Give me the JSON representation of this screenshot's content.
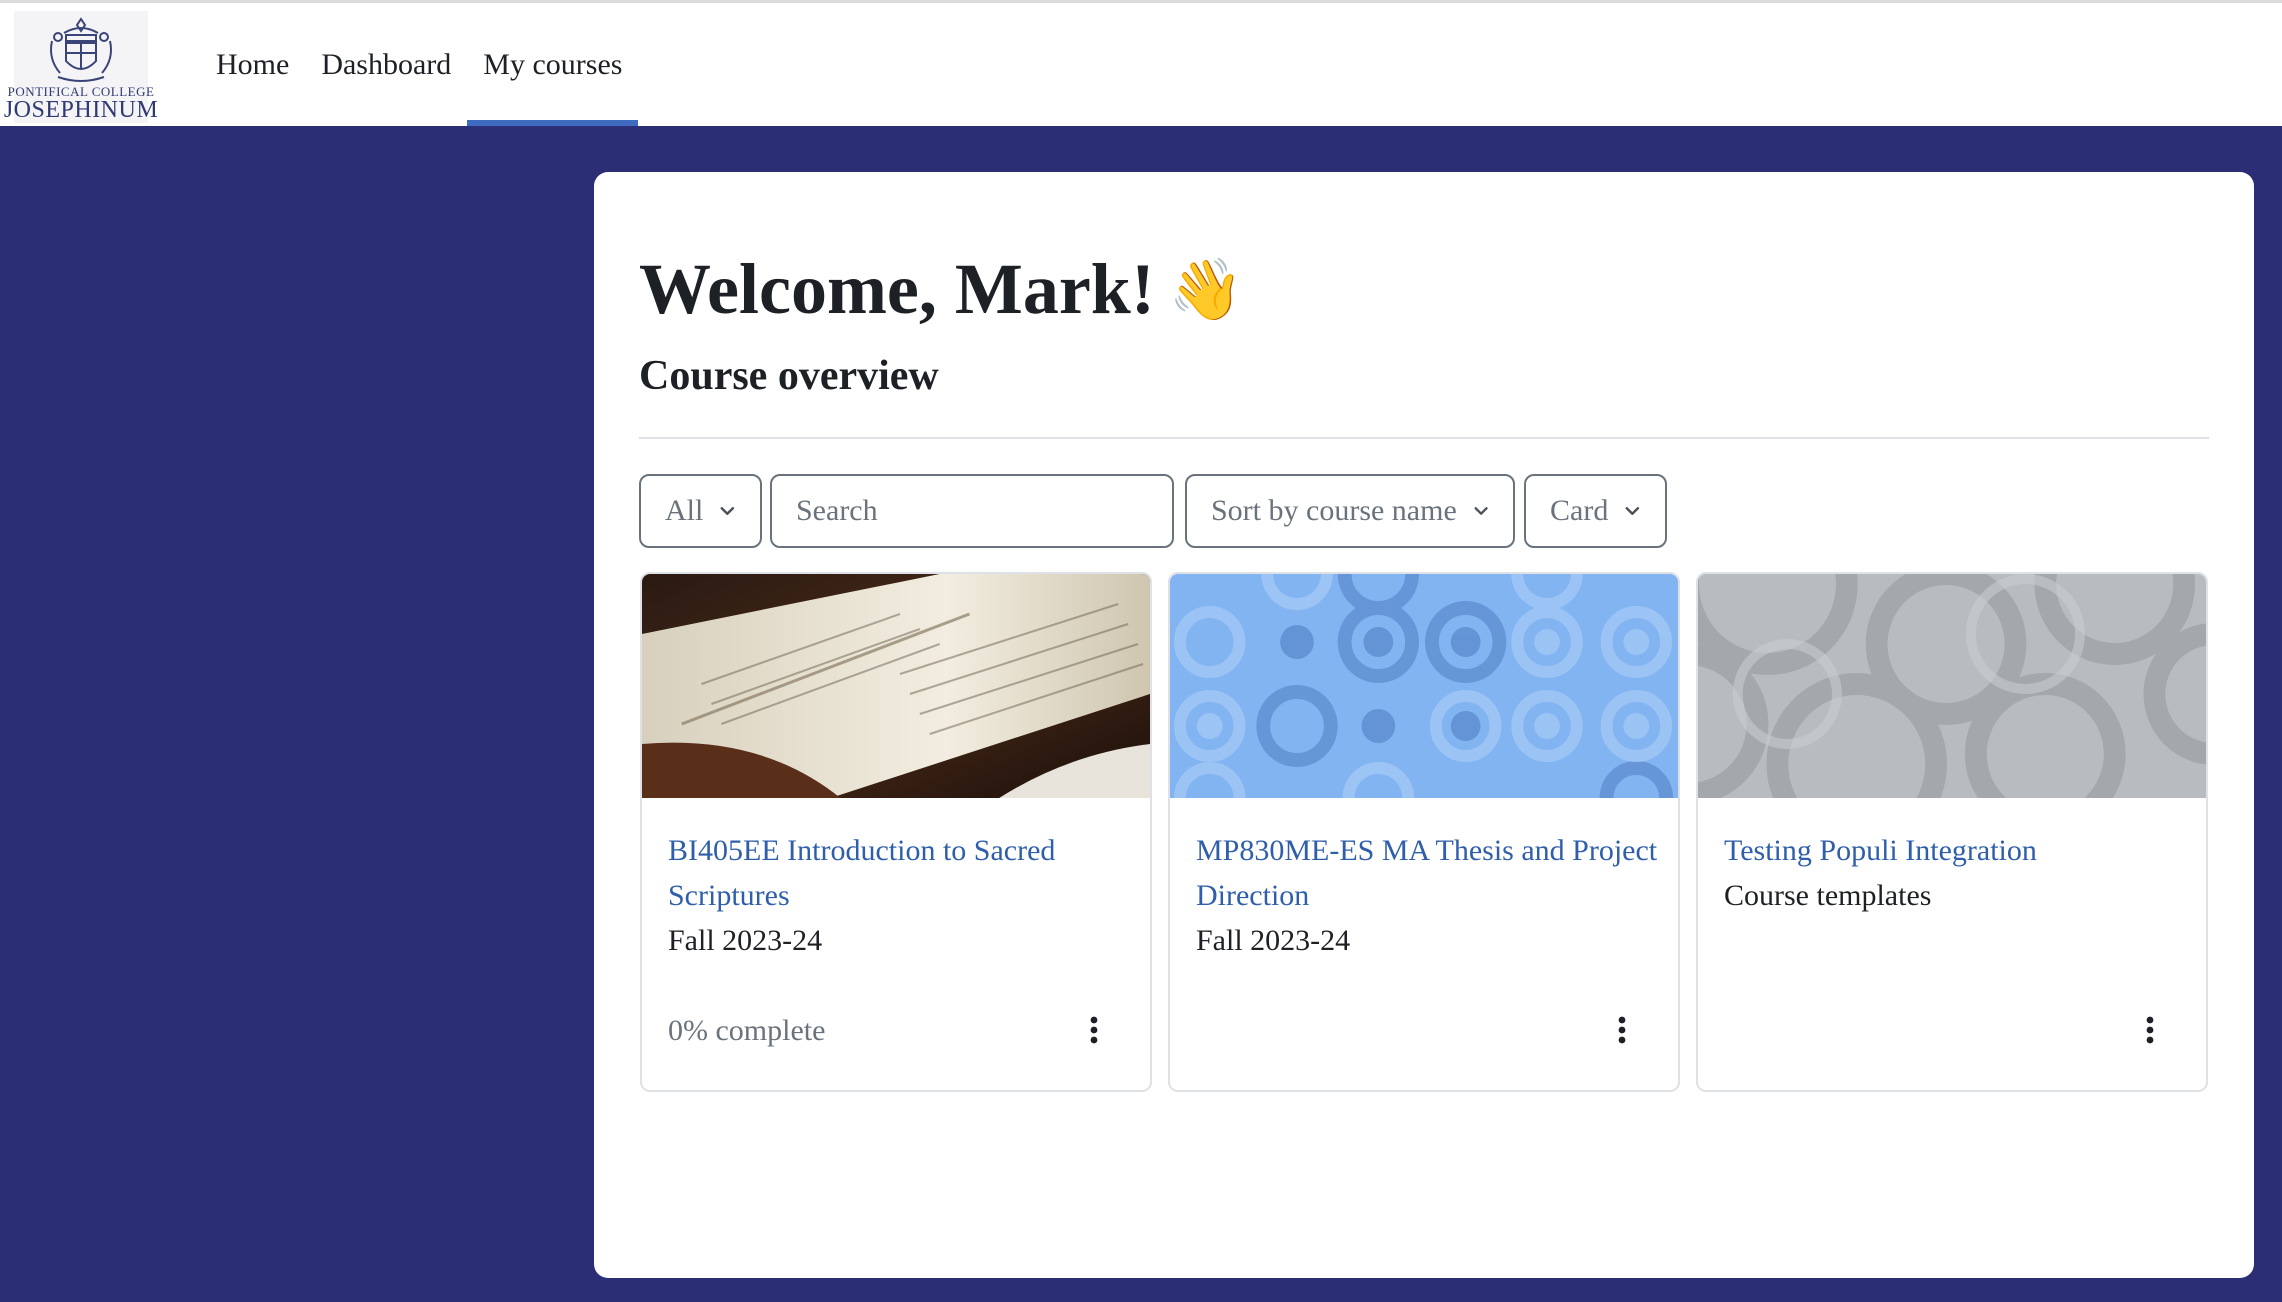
{
  "header": {
    "logo": {
      "line1": "PONTIFICAL COLLEGE",
      "line2": "JOSEPHINUM"
    },
    "nav": [
      {
        "label": "Home",
        "active": false
      },
      {
        "label": "Dashboard",
        "active": false
      },
      {
        "label": "My courses",
        "active": true
      }
    ]
  },
  "main": {
    "welcome": "Welcome, Mark!",
    "welcome_emoji": "👋",
    "section_title": "Course overview",
    "filters": {
      "grouping": "All",
      "search_placeholder": "Search",
      "search_value": "",
      "sort": "Sort by course name",
      "view": "Card"
    },
    "courses": [
      {
        "name": "BI405EE Introduction to Sacred Scriptures",
        "category": "Fall 2023-24",
        "progress_label": "0% complete",
        "progress": 0,
        "image": "open-bible-photo"
      },
      {
        "name": "MP830ME-ES MA Thesis and Project Direction",
        "category": "Fall 2023-24",
        "progress_label": "",
        "image": "blue-circles-pattern"
      },
      {
        "name": "Testing Populi Integration",
        "category": "Course templates",
        "progress_label": "",
        "image": "gray-circles-pattern"
      }
    ]
  },
  "colors": {
    "background": "#2b2e75",
    "link": "#2f5eaa",
    "nav_active": "#3e6bbf",
    "text": "#1d2125",
    "muted": "#6a737b"
  }
}
